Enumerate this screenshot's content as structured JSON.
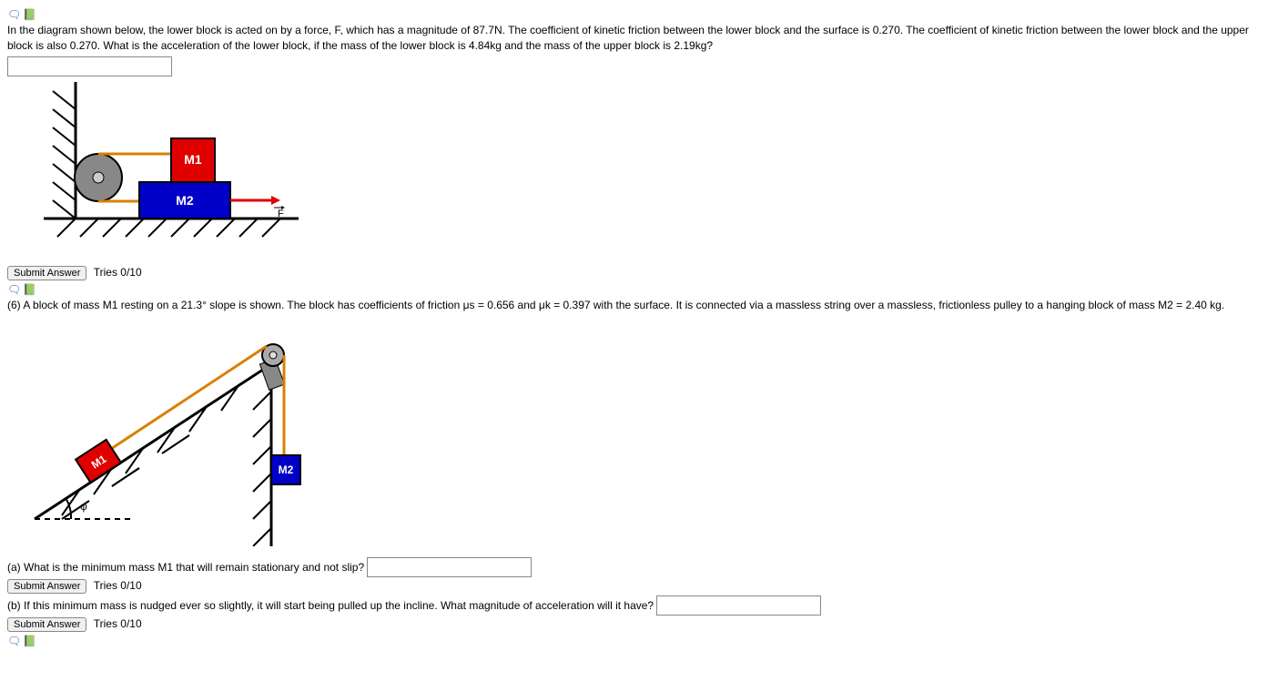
{
  "q1": {
    "text": "In the diagram shown below, the lower block is acted on by a force, F, which has a magnitude of 87.7N. The coefficient of kinetic friction between the lower block and the surface is 0.270. The coefficient of kinetic friction between the lower block and the upper block is also 0.270. What is the acceleration of the lower block, if the mass of the lower block is 4.84kg and the mass of the upper block is 2.19kg?",
    "submit": "Submit Answer",
    "tries": "Tries 0/10",
    "diagram": {
      "m1": "M1",
      "m2": "M2",
      "force": "F"
    }
  },
  "q2": {
    "text": "(6) A block of mass M1 resting on a 21.3° slope is shown. The block has coefficients of friction μs = 0.656 and μk = 0.397 with the surface. It is connected via a massless string over a massless, frictionless pulley to a hanging block of mass M2 = 2.40 kg.",
    "diagram": {
      "m1": "M1",
      "m2": "M2",
      "angle": "φ"
    },
    "part_a": "(a) What is the minimum mass M1 that will remain stationary and not slip?",
    "part_b": "(b) If this minimum mass is nudged ever so slightly, it will start being pulled up the incline. What magnitude of acceleration will it have?",
    "submit": "Submit Answer",
    "tries": "Tries 0/10"
  }
}
